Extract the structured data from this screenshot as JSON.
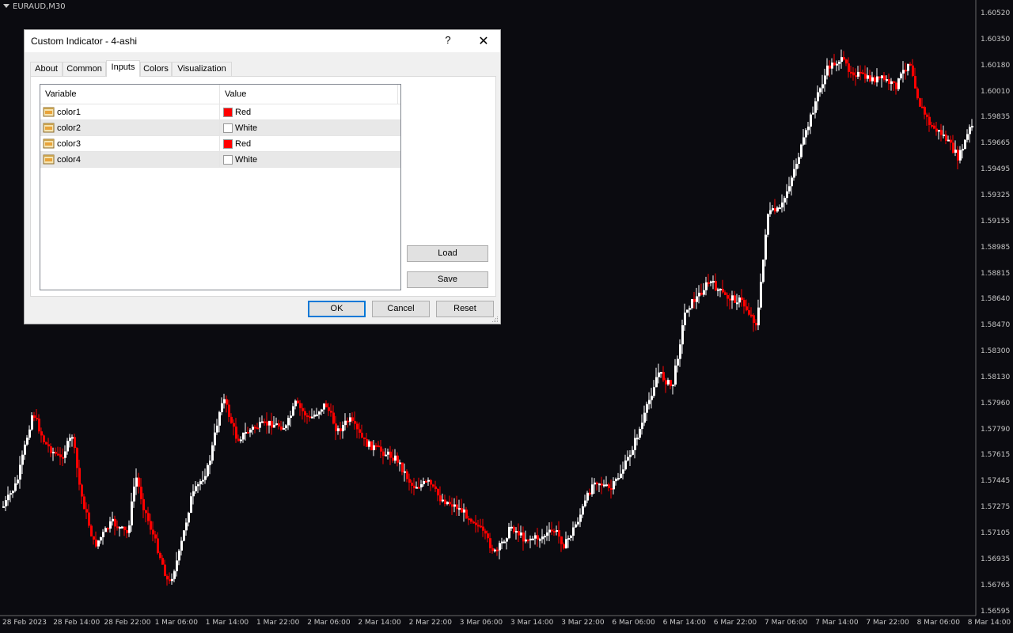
{
  "chart": {
    "symbol_label": "EURAUD,M30",
    "price_axis": [
      "1.60520",
      "1.60350",
      "1.60180",
      "1.60010",
      "1.59835",
      "1.59665",
      "1.59495",
      "1.59325",
      "1.59155",
      "1.58985",
      "1.58815",
      "1.58640",
      "1.58470",
      "1.58300",
      "1.58130",
      "1.57960",
      "1.57790",
      "1.57615",
      "1.57445",
      "1.57275",
      "1.57105",
      "1.56935",
      "1.56765",
      "1.56595"
    ],
    "time_axis": [
      "28 Feb 2023",
      "28 Feb 14:00",
      "28 Feb 22:00",
      "1 Mar 06:00",
      "1 Mar 14:00",
      "1 Mar 22:00",
      "2 Mar 06:00",
      "2 Mar 14:00",
      "2 Mar 22:00",
      "3 Mar 06:00",
      "3 Mar 14:00",
      "3 Mar 22:00",
      "6 Mar 06:00",
      "6 Mar 14:00",
      "6 Mar 22:00",
      "7 Mar 06:00",
      "7 Mar 14:00",
      "7 Mar 22:00",
      "8 Mar 06:00",
      "8 Mar 14:00"
    ],
    "bull_color": "#ffffff",
    "bear_color": "#ff0000",
    "background": "#0b0b10"
  },
  "dialog": {
    "title": "Custom Indicator - 4-ashi",
    "help_label": "?",
    "close_label": "✕",
    "tabs": [
      {
        "label": "About",
        "active": false
      },
      {
        "label": "Common",
        "active": false
      },
      {
        "label": "Inputs",
        "active": true
      },
      {
        "label": "Colors",
        "active": false
      },
      {
        "label": "Visualization",
        "active": false
      }
    ],
    "grid": {
      "headers": {
        "variable": "Variable",
        "value": "Value"
      },
      "rows": [
        {
          "variable": "color1",
          "value": "Red",
          "swatch": "#ff0000"
        },
        {
          "variable": "color2",
          "value": "White",
          "swatch": "#ffffff"
        },
        {
          "variable": "color3",
          "value": "Red",
          "swatch": "#ff0000"
        },
        {
          "variable": "color4",
          "value": "White",
          "swatch": "#ffffff"
        }
      ]
    },
    "buttons": {
      "load": "Load",
      "save": "Save",
      "ok": "OK",
      "cancel": "Cancel",
      "reset": "Reset"
    }
  }
}
